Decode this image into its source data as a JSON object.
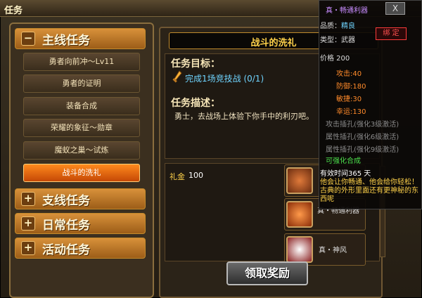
{
  "window": {
    "title": "任务"
  },
  "categories": [
    {
      "sign": "−",
      "label": "主线任务"
    },
    {
      "sign": "+",
      "label": "支线任务"
    },
    {
      "sign": "+",
      "label": "日常任务"
    },
    {
      "sign": "+",
      "label": "活动任务"
    }
  ],
  "quests": [
    {
      "label": "勇者向前冲～Lv11"
    },
    {
      "label": "勇者的证明"
    },
    {
      "label": "装备合成"
    },
    {
      "label": "荣耀的象征～勋章"
    },
    {
      "label": "魔蚁之巢～试炼"
    },
    {
      "label": "战斗的洗礼"
    }
  ],
  "detail": {
    "title": "战斗的洗礼",
    "goal_header": "任务目标：",
    "goal_text": "完成1场竞技战 (0/1)",
    "desc_header": "任务描述：",
    "desc_text": "勇士，去战场上体验下你手中的利刃吧。"
  },
  "reward": {
    "gold_label": "礼金",
    "gold_value": "100",
    "items": [
      {
        "name": "真"
      },
      {
        "name": "真・畅通利器"
      },
      {
        "name": "真・神风"
      }
    ],
    "claim_label": "领取奖励"
  },
  "tooltip": {
    "name": "真・畅通利器",
    "close": "X",
    "quality_label": "品质",
    "quality": "精良",
    "type_label": "类型",
    "type": "武器",
    "lock": "绑 定",
    "price": "价格 200",
    "attrs": [
      "攻击:40",
      "防御:180",
      "敏捷:30",
      "幸运:130"
    ],
    "slots": [
      "攻击插孔(强化3级激活)",
      "属性插孔(强化6级激活)",
      "属性插孔(强化9级激活)"
    ],
    "enhance": "可强化合成",
    "duration": "有效时间365 天",
    "flavor": "他会让你畅通、他会给你轻松！古典的外形里面还有更神秘的东西呢"
  },
  "colors": {
    "accent": "#ff8a1e",
    "goal": "#6fd4ff",
    "attr": "#ff8a2a",
    "lock": "#ff3b3b"
  }
}
